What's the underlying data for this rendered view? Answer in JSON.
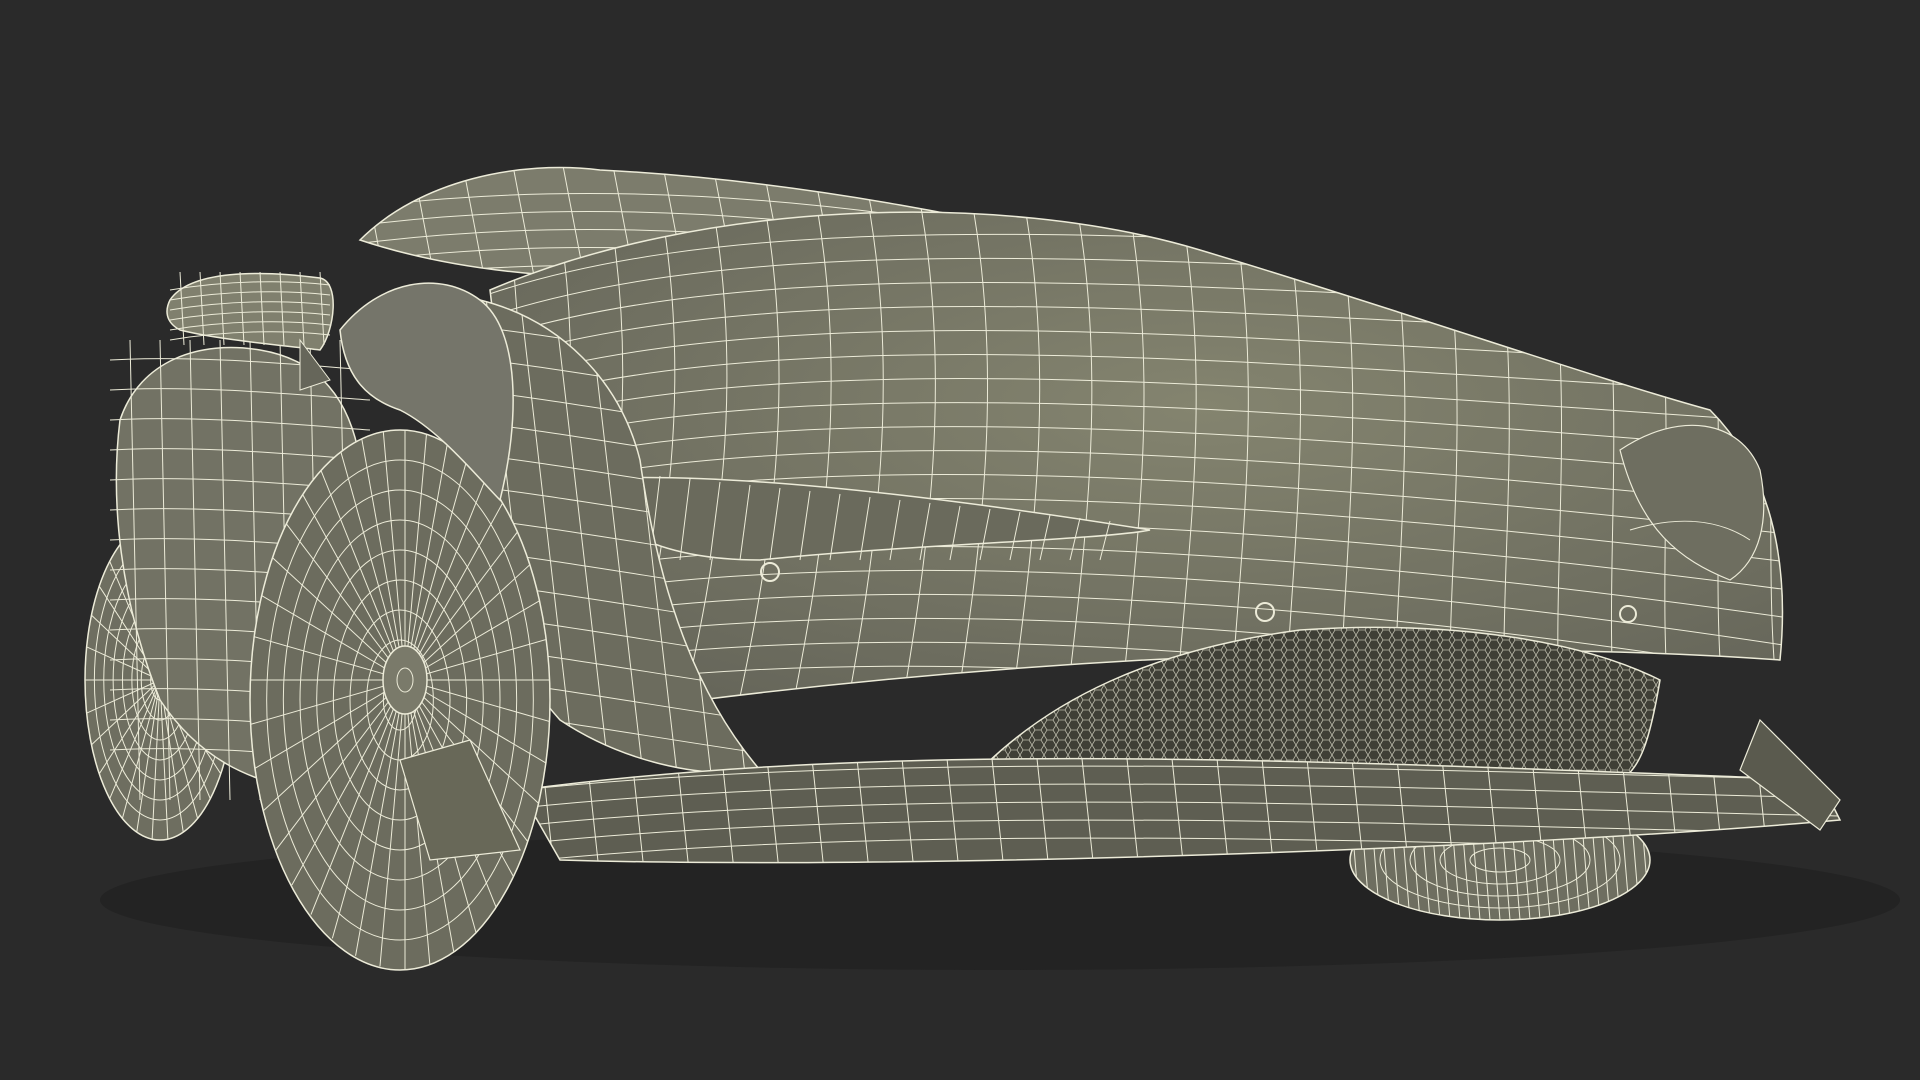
{
  "scene": {
    "subject": "car-wireframe",
    "colors": {
      "background": "#2a2a2a",
      "body_fill": "#7a7a6a",
      "body_fill_dark": "#5e5e50",
      "shadow_fill": "#4a4a40",
      "grille_fill": "#3f3f36",
      "wire": "#ecebd8"
    }
  }
}
